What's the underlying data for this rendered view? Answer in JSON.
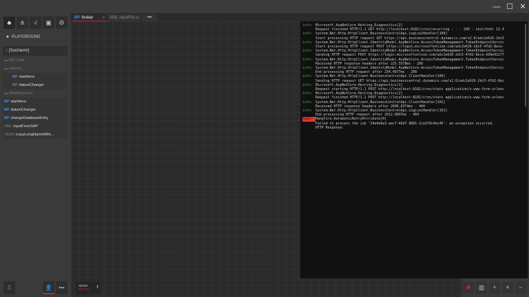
{
  "window": {
    "minimize": "—",
    "maximize": "☐",
    "close": "✕"
  },
  "toolbar": [
    {
      "icon": "hierarchy-icon",
      "glyph": "♣"
    },
    {
      "icon": "graph-icon",
      "glyph": "⋔"
    },
    {
      "icon": "formula-icon",
      "glyph": "√"
    },
    {
      "icon": "image-icon",
      "glyph": "▣"
    },
    {
      "icon": "gear-icon",
      "glyph": "⚙"
    }
  ],
  "sidebar": {
    "title": "PLAYGROUND",
    "search_value": "[Suchterm]",
    "items": [
      {
        "type": "folder",
        "label": "API Calls"
      },
      {
        "type": "folder",
        "label": "Helpers"
      },
      {
        "type": "BP",
        "label": "startHere",
        "indent": true
      },
      {
        "type": "BP",
        "label": "datumChanger",
        "indent": true
      },
      {
        "type": "folder",
        "label": "WebRequests"
      },
      {
        "type": "BP",
        "label": "startHere"
      },
      {
        "type": "BP",
        "label": "datumChanger"
      },
      {
        "type": "BP",
        "label": "changeDatabaseEntry"
      },
      {
        "type": "XML",
        "label": "inputFromSAP"
      },
      {
        "type": "JSON",
        "label": "crazyLongNameWith..."
      }
    ]
  },
  "tabs": [
    {
      "type": "BP",
      "label": "foobar",
      "close": "x",
      "active": true
    },
    {
      "type": "XML",
      "label": "inputFro...",
      "close": "x"
    }
  ],
  "tabs_more": "•••",
  "console": [
    [
      "info",
      "Microsoft.AspNetCore.Hosting.Diagnostics[2]"
    ],
    [
      "",
      "Request finished HTTP/1.1 GET http://localhost:8181/cron/recurring - - - 200 - text/html 12.4"
    ],
    [
      "info",
      "System.Net.Http.HttpClient.BusinessCentralApi.LogicalHandler[100]"
    ],
    [
      "",
      "Start processing HTTP request GET https://api.businesscentral.dynamics.com/v2.0/adc2e626-2dc5"
    ],
    [
      "info",
      "System.Net.Http.HttpClient.IdentityModel.AspNetCore.AccessTokenManagement.TokenEndpointServic"
    ],
    [
      "",
      "Start processing HTTP request POST https://login.microsoftonline.com/adc2e626-2dc5-47d2-8ece-"
    ],
    [
      "info",
      "System.Net.Http.HttpClient.IdentityModel.AspNetCore.AccessTokenManagement.TokenEndpointServic"
    ],
    [
      "",
      "Sending HTTP request POST https://login.microsoftonline.com/adc2e626-2dc5-47d2-8ece-b99e91277"
    ],
    [
      "info",
      "System.Net.Http.HttpClient.IdentityModel.AspNetCore.AccessTokenManagement.TokenEndpointServic"
    ],
    [
      "",
      "Received HTTP response headers after 225.5578ms - 200"
    ],
    [
      "info",
      "System.Net.Http.HttpClient.IdentityModel.AspNetCore.AccessTokenManagement.TokenEndpointServic"
    ],
    [
      "",
      "End processing HTTP request after 234.4877ms - 200"
    ],
    [
      "info",
      "System.Net.Http.HttpClient.BusinessCentralApi.ClientHandler[100]"
    ],
    [
      "",
      "Sending HTTP request GET https://api.businesscentral.dynamics.com/v2.0/adc2e626-2dc5-47d2-8ec"
    ],
    [
      "info",
      "Microsoft.AspNetCore.Hosting.Diagnostics[1]"
    ],
    [
      "",
      "Request starting HTTP/1.1 POST http://localhost:8181/cron/stats application/x-www-form-urlenc"
    ],
    [
      "info",
      "Microsoft.AspNetCore.Hosting.Diagnostics[2]"
    ],
    [
      "",
      "Request finished HTTP/1.1 POST http://localhost:8181/cron/stats application/x-www-form-urlenc"
    ],
    [
      "info",
      "System.Net.Http.HttpClient.BusinessCentralApi.ClientHandler[101]"
    ],
    [
      "",
      "Received HTTP response headers after 2606.8374ms - 404"
    ],
    [
      "info",
      "System.Net.Http.HttpClient.BusinessCentralApi.LogicalHandler[101]"
    ],
    [
      "",
      "End processing HTTP request after 2912.8897ms - 404"
    ],
    [
      "fail",
      "Hangfire.AutomaticRetryAttribute[0]"
    ],
    [
      "",
      "Failed to process the job '24e4e9a3-aec7-46d7-8881-2ca3f9c4ec46': an exception occurred."
    ],
    [
      "",
      "HTTP Response:"
    ]
  ],
  "level_labels": {
    "info": "info:",
    "fail": "fail:"
  },
  "bottom": {
    "news_line1": "NEWS",
    "news_line2": "&BLOG",
    "news_arrow": "›",
    "more": "•••",
    "zoom_label": "4"
  },
  "colors": {
    "accent": "#c0282d",
    "bp": "#3a8ee6",
    "info": "#3cb043"
  }
}
